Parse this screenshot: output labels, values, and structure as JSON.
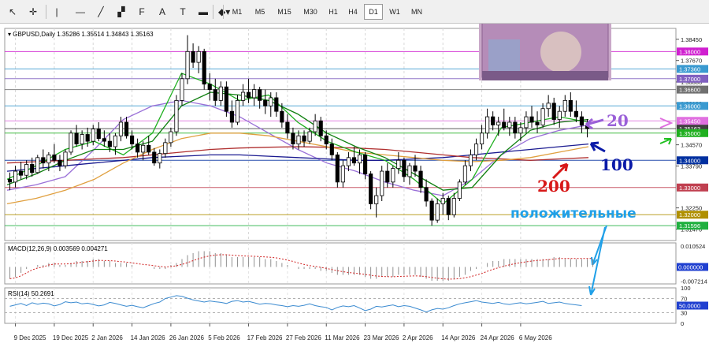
{
  "toolbar": {
    "tools": [
      {
        "name": "cursor-icon",
        "glyph": "↖"
      },
      {
        "name": "crosshair-icon",
        "glyph": "✛"
      },
      {
        "name": "vertical-line-icon",
        "glyph": "|"
      },
      {
        "name": "horizontal-line-icon",
        "glyph": "—"
      },
      {
        "name": "trendline-icon",
        "glyph": "╱"
      },
      {
        "name": "channel-icon",
        "glyph": "▞"
      },
      {
        "name": "fibonacci-icon",
        "glyph": "F"
      },
      {
        "name": "text-icon",
        "glyph": "A"
      },
      {
        "name": "label-icon",
        "glyph": "T"
      },
      {
        "name": "rectangle-icon",
        "glyph": "▬"
      },
      {
        "name": "shapes-icon",
        "glyph": "◆▾"
      }
    ],
    "timeframes": [
      "M1",
      "M5",
      "M15",
      "M30",
      "H1",
      "H4",
      "D1",
      "W1",
      "MN"
    ],
    "selected_timeframe": "D1"
  },
  "chart_data": {
    "type": "candlestick",
    "header": "GBPUSD,Daily  1.35286 1.35514 1.34843 1.35163",
    "x_ticks": [
      "9 Dec 2025",
      "19 Dec 2025",
      "2 Jan 2026",
      "14 Jan 2026",
      "26 Jan 2026",
      "5 Feb 2026",
      "17 Feb 2026",
      "27 Feb 2026",
      "11 Mar 2026",
      "23 Mar 2026",
      "2 Apr 2026",
      "14 Apr 2026",
      "24 Apr 2026",
      "6 May 2026"
    ],
    "price_ticks": [
      "1.38450",
      "1.37670",
      "1.36880",
      "1.36100",
      "1.34570",
      "1.33790",
      "1.32250",
      "1.31470"
    ],
    "price_levels": [
      {
        "label": "1.38000",
        "value": 1.38,
        "color": "#d020d0"
      },
      {
        "label": "1.37360",
        "value": 1.3736,
        "color": "#3a9ad0"
      },
      {
        "label": "1.37000",
        "value": 1.37,
        "color": "#8060c0"
      },
      {
        "label": "1.36600",
        "value": 1.366,
        "color": "#707070"
      },
      {
        "label": "1.36000",
        "value": 1.36,
        "color": "#3a9ad0"
      },
      {
        "label": "1.35450",
        "value": 1.3545,
        "color": "#e070e0"
      },
      {
        "label": "1.35163",
        "value": 1.35163,
        "color": "#404040"
      },
      {
        "label": "1.35000",
        "value": 1.35,
        "color": "#20b020"
      },
      {
        "label": "1.34000",
        "value": 1.34,
        "color": "#0030a0"
      },
      {
        "label": "1.33000",
        "value": 1.33,
        "color": "#c04050"
      },
      {
        "label": "1.32000",
        "value": 1.32,
        "color": "#b09000"
      },
      {
        "label": "1.31596",
        "value": 1.31596,
        "color": "#20b040"
      }
    ],
    "y_range": [
      1.3105,
      1.3885
    ],
    "annotations": [
      {
        "text": "20",
        "color": "#9a60d8"
      },
      {
        "text": "100",
        "color": "#0a1aa8"
      },
      {
        "text": "200",
        "color": "#d81818"
      },
      {
        "text": "положительные",
        "color": "#20a0e8"
      }
    ],
    "candles": [
      [
        1.333,
        1.3355,
        1.329,
        1.332
      ],
      [
        1.332,
        1.338,
        1.33,
        1.336
      ],
      [
        1.336,
        1.3395,
        1.333,
        1.3345
      ],
      [
        1.3345,
        1.34,
        1.333,
        1.3385
      ],
      [
        1.3385,
        1.341,
        1.334,
        1.3355
      ],
      [
        1.3355,
        1.342,
        1.335,
        1.341
      ],
      [
        1.341,
        1.344,
        1.337,
        1.339
      ],
      [
        1.339,
        1.343,
        1.336,
        1.342
      ],
      [
        1.342,
        1.346,
        1.339,
        1.34
      ],
      [
        1.34,
        1.342,
        1.336,
        1.338
      ],
      [
        1.338,
        1.344,
        1.337,
        1.343
      ],
      [
        1.343,
        1.351,
        1.342,
        1.35
      ],
      [
        1.35,
        1.353,
        1.345,
        1.346
      ],
      [
        1.346,
        1.351,
        1.344,
        1.3495
      ],
      [
        1.3495,
        1.352,
        1.345,
        1.347
      ],
      [
        1.347,
        1.353,
        1.3455,
        1.3515
      ],
      [
        1.3515,
        1.354,
        1.347,
        1.348
      ],
      [
        1.348,
        1.351,
        1.345,
        1.347
      ],
      [
        1.347,
        1.35,
        1.343,
        1.345
      ],
      [
        1.345,
        1.35,
        1.342,
        1.349
      ],
      [
        1.349,
        1.356,
        1.347,
        1.354
      ],
      [
        1.354,
        1.356,
        1.348,
        1.349
      ],
      [
        1.349,
        1.351,
        1.344,
        1.346
      ],
      [
        1.346,
        1.348,
        1.341,
        1.343
      ],
      [
        1.343,
        1.347,
        1.34,
        1.3455
      ],
      [
        1.3455,
        1.349,
        1.342,
        1.343
      ],
      [
        1.343,
        1.3445,
        1.338,
        1.339
      ],
      [
        1.339,
        1.344,
        1.337,
        1.3425
      ],
      [
        1.3425,
        1.348,
        1.341,
        1.3465
      ],
      [
        1.3465,
        1.352,
        1.345,
        1.3505
      ],
      [
        1.3505,
        1.364,
        1.349,
        1.362
      ],
      [
        1.362,
        1.372,
        1.36,
        1.37
      ],
      [
        1.37,
        1.386,
        1.368,
        1.38
      ],
      [
        1.38,
        1.383,
        1.374,
        1.376
      ],
      [
        1.376,
        1.382,
        1.372,
        1.38
      ],
      [
        1.38,
        1.381,
        1.366,
        1.368
      ],
      [
        1.368,
        1.372,
        1.362,
        1.366
      ],
      [
        1.366,
        1.37,
        1.36,
        1.362
      ],
      [
        1.362,
        1.369,
        1.36,
        1.367
      ],
      [
        1.367,
        1.369,
        1.356,
        1.358
      ],
      [
        1.358,
        1.362,
        1.352,
        1.354
      ],
      [
        1.354,
        1.364,
        1.353,
        1.362
      ],
      [
        1.362,
        1.368,
        1.36,
        1.365
      ],
      [
        1.365,
        1.37,
        1.361,
        1.363
      ],
      [
        1.363,
        1.368,
        1.36,
        1.366
      ],
      [
        1.366,
        1.367,
        1.359,
        1.362
      ],
      [
        1.362,
        1.366,
        1.357,
        1.36
      ],
      [
        1.36,
        1.365,
        1.356,
        1.363
      ],
      [
        1.363,
        1.365,
        1.356,
        1.358
      ],
      [
        1.358,
        1.361,
        1.352,
        1.354
      ],
      [
        1.354,
        1.357,
        1.348,
        1.35
      ],
      [
        1.35,
        1.352,
        1.344,
        1.346
      ],
      [
        1.346,
        1.351,
        1.344,
        1.349
      ],
      [
        1.349,
        1.351,
        1.345,
        1.347
      ],
      [
        1.347,
        1.352,
        1.346,
        1.3505
      ],
      [
        1.3505,
        1.357,
        1.349,
        1.3545
      ],
      [
        1.3545,
        1.356,
        1.347,
        1.349
      ],
      [
        1.349,
        1.351,
        1.344,
        1.346
      ],
      [
        1.346,
        1.348,
        1.34,
        1.342
      ],
      [
        1.342,
        1.343,
        1.33,
        1.332
      ],
      [
        1.332,
        1.34,
        1.33,
        1.338
      ],
      [
        1.338,
        1.343,
        1.336,
        1.341
      ],
      [
        1.341,
        1.345,
        1.338,
        1.339
      ],
      [
        1.339,
        1.344,
        1.335,
        1.342
      ],
      [
        1.342,
        1.343,
        1.333,
        1.335
      ],
      [
        1.335,
        1.336,
        1.322,
        1.324
      ],
      [
        1.324,
        1.33,
        1.319,
        1.327
      ],
      [
        1.327,
        1.338,
        1.325,
        1.336
      ],
      [
        1.336,
        1.339,
        1.33,
        1.332
      ],
      [
        1.332,
        1.338,
        1.33,
        1.337
      ],
      [
        1.337,
        1.343,
        1.335,
        1.34
      ],
      [
        1.34,
        1.341,
        1.332,
        1.334
      ],
      [
        1.334,
        1.339,
        1.331,
        1.338
      ],
      [
        1.338,
        1.342,
        1.334,
        1.336
      ],
      [
        1.336,
        1.338,
        1.328,
        1.33
      ],
      [
        1.33,
        1.333,
        1.323,
        1.325
      ],
      [
        1.325,
        1.326,
        1.316,
        1.318
      ],
      [
        1.318,
        1.326,
        1.317,
        1.324
      ],
      [
        1.324,
        1.328,
        1.32,
        1.326
      ],
      [
        1.326,
        1.327,
        1.318,
        1.32
      ],
      [
        1.32,
        1.328,
        1.319,
        1.326
      ],
      [
        1.326,
        1.333,
        1.325,
        1.332
      ],
      [
        1.332,
        1.34,
        1.331,
        1.338
      ],
      [
        1.338,
        1.344,
        1.336,
        1.342
      ],
      [
        1.342,
        1.348,
        1.34,
        1.346
      ],
      [
        1.346,
        1.353,
        1.344,
        1.35
      ],
      [
        1.35,
        1.359,
        1.348,
        1.356
      ],
      [
        1.356,
        1.358,
        1.351,
        1.353
      ],
      [
        1.353,
        1.356,
        1.349,
        1.354
      ],
      [
        1.354,
        1.359,
        1.351,
        1.352
      ],
      [
        1.352,
        1.356,
        1.349,
        1.354
      ],
      [
        1.354,
        1.356,
        1.348,
        1.35
      ],
      [
        1.35,
        1.354,
        1.347,
        1.352
      ],
      [
        1.352,
        1.358,
        1.35,
        1.356
      ],
      [
        1.356,
        1.36,
        1.352,
        1.354
      ],
      [
        1.354,
        1.358,
        1.35,
        1.353
      ],
      [
        1.353,
        1.361,
        1.352,
        1.359
      ],
      [
        1.359,
        1.364,
        1.356,
        1.361
      ],
      [
        1.361,
        1.363,
        1.353,
        1.355
      ],
      [
        1.355,
        1.36,
        1.352,
        1.358
      ],
      [
        1.358,
        1.364,
        1.356,
        1.362
      ],
      [
        1.362,
        1.365,
        1.356,
        1.358
      ],
      [
        1.358,
        1.362,
        1.354,
        1.356
      ],
      [
        1.356,
        1.358,
        1.35,
        1.3529
      ],
      [
        1.35286,
        1.35514,
        1.34843,
        1.35163
      ]
    ],
    "overlays": [
      {
        "name": "MA20",
        "color": "#9a70d8",
        "values": [
          1.329,
          1.331,
          1.334,
          1.344,
          1.355,
          1.36,
          1.362,
          1.36,
          1.356,
          1.35,
          1.344,
          1.339,
          1.336,
          1.332,
          1.329,
          1.327,
          1.333,
          1.342,
          1.348,
          1.351,
          1.353
        ]
      },
      {
        "name": "MA100",
        "color": "#1a1a90",
        "values": [
          1.336,
          1.337,
          1.338,
          1.339,
          1.34,
          1.341,
          1.3415,
          1.342,
          1.342,
          1.3415,
          1.341,
          1.3405,
          1.34,
          1.34,
          1.3405,
          1.341,
          1.342,
          1.343,
          1.344,
          1.345,
          1.346
        ]
      },
      {
        "name": "MA200",
        "color": "#b03030",
        "values": [
          1.339,
          1.3395,
          1.34,
          1.3405,
          1.341,
          1.342,
          1.343,
          1.344,
          1.3445,
          1.3448,
          1.345,
          1.3448,
          1.3445,
          1.344,
          1.343,
          1.342,
          1.341,
          1.3405,
          1.34,
          1.3405,
          1.341
        ]
      },
      {
        "name": "MA50",
        "color": "#e0a040",
        "values": [
          1.324,
          1.326,
          1.329,
          1.333,
          1.339,
          1.344,
          1.348,
          1.35,
          1.35,
          1.349,
          1.347,
          1.345,
          1.343,
          1.342,
          1.341,
          1.34,
          1.3395,
          1.34,
          1.341,
          1.343,
          1.345
        ]
      },
      {
        "name": "EMA5",
        "color": "#20b020",
        "values": [
          1.333,
          1.338,
          1.344,
          1.347,
          1.342,
          1.35,
          1.372,
          1.368,
          1.362,
          1.364,
          1.354,
          1.347,
          1.343,
          1.34,
          1.333,
          1.324,
          1.333,
          1.352,
          1.354,
          1.356,
          1.354
        ]
      },
      {
        "name": "EMA13",
        "color": "#108010",
        "values": [
          1.331,
          1.335,
          1.34,
          1.344,
          1.344,
          1.347,
          1.36,
          1.365,
          1.364,
          1.362,
          1.357,
          1.35,
          1.345,
          1.341,
          1.335,
          1.329,
          1.33,
          1.342,
          1.351,
          1.354,
          1.355
        ]
      }
    ],
    "macd": {
      "label": "MACD(12,26,9) 0.003569 0.004271",
      "ticks": [
        "0.010524",
        "0.000000",
        "-0.007214"
      ],
      "y_range": [
        -0.0086,
        0.0122
      ],
      "histogram": [
        -0.006,
        -0.005,
        -0.003,
        -0.001,
        0.0,
        0.001,
        0.001,
        0.002,
        0.002,
        0.001,
        0.001,
        0.002,
        0.003,
        0.003,
        0.003,
        0.004,
        0.004,
        0.003,
        0.003,
        0.002,
        0.002,
        0.002,
        0.001,
        0.0,
        0.0,
        0.0,
        -0.001,
        -0.001,
        -0.001,
        0.001,
        0.002,
        0.004,
        0.006,
        0.007,
        0.008,
        0.008,
        0.008,
        0.007,
        0.007,
        0.006,
        0.005,
        0.005,
        0.005,
        0.005,
        0.005,
        0.005,
        0.004,
        0.004,
        0.003,
        0.002,
        0.001,
        0.0,
        -0.001,
        -0.001,
        -0.001,
        -0.001,
        -0.002,
        -0.002,
        -0.003,
        -0.004,
        -0.004,
        -0.004,
        -0.004,
        -0.004,
        -0.005,
        -0.006,
        -0.006,
        -0.005,
        -0.005,
        -0.005,
        -0.004,
        -0.004,
        -0.004,
        -0.004,
        -0.005,
        -0.006,
        -0.007,
        -0.007,
        -0.007,
        -0.007,
        -0.006,
        -0.005,
        -0.004,
        -0.002,
        -0.001,
        0.0,
        0.002,
        0.003,
        0.003,
        0.004,
        0.004,
        0.004,
        0.004,
        0.004,
        0.004,
        0.004,
        0.004,
        0.004,
        0.005,
        0.005,
        0.004,
        0.004,
        0.004,
        0.004,
        0.004,
        0.004
      ],
      "signal": [
        -0.006,
        -0.0055,
        -0.0045,
        -0.003,
        -0.0015,
        -0.0005,
        0.0,
        0.001,
        0.0015,
        0.0015,
        0.0015,
        0.0017,
        0.002,
        0.0024,
        0.0027,
        0.003,
        0.0033,
        0.0033,
        0.0032,
        0.003,
        0.0027,
        0.0025,
        0.0021,
        0.0017,
        0.0013,
        0.001,
        0.0006,
        0.0003,
        0.0,
        0.0002,
        0.0006,
        0.0013,
        0.0022,
        0.0032,
        0.0042,
        0.005,
        0.0056,
        0.006,
        0.0062,
        0.0062,
        0.006,
        0.0058,
        0.0056,
        0.0055,
        0.0054,
        0.0053,
        0.0051,
        0.0049,
        0.0046,
        0.0041,
        0.0035,
        0.0028,
        0.002,
        0.0013,
        0.0007,
        0.0003,
        -0.0002,
        -0.0007,
        -0.0013,
        -0.0019,
        -0.0024,
        -0.0028,
        -0.0031,
        -0.0034,
        -0.0038,
        -0.0042,
        -0.0046,
        -0.0048,
        -0.0049,
        -0.005,
        -0.0048,
        -0.0047,
        -0.0046,
        -0.0045,
        -0.0046,
        -0.0049,
        -0.0053,
        -0.0057,
        -0.006,
        -0.0062,
        -0.0061,
        -0.0059,
        -0.0055,
        -0.0049,
        -0.0041,
        -0.0033,
        -0.0022,
        -0.0012,
        -0.0004,
        0.0004,
        0.0011,
        0.0017,
        0.0022,
        0.0026,
        0.003,
        0.0033,
        0.0035,
        0.0037,
        0.004,
        0.0043,
        0.0043,
        0.0043,
        0.0043,
        0.0043,
        0.0043,
        0.0043
      ]
    },
    "rsi": {
      "label": "RSI(14) 50.2691",
      "ticks": [
        "100",
        "70",
        "50.0000",
        "30",
        "0"
      ],
      "levels": [
        70,
        30
      ],
      "values": [
        48,
        52,
        56,
        50,
        58,
        54,
        57,
        55,
        49,
        53,
        61,
        58,
        60,
        55,
        57,
        53,
        49,
        52,
        59,
        56,
        52,
        48,
        51,
        47,
        44,
        50,
        56,
        60,
        70,
        74,
        78,
        76,
        71,
        66,
        63,
        60,
        63,
        61,
        59,
        56,
        62,
        64,
        60,
        62,
        58,
        54,
        56,
        55,
        52,
        50,
        47,
        50,
        48,
        51,
        55,
        50,
        47,
        45,
        38,
        45,
        49,
        47,
        50,
        43,
        36,
        40,
        48,
        46,
        49,
        52,
        47,
        50,
        48,
        43,
        38,
        32,
        38,
        42,
        40,
        44,
        50,
        55,
        58,
        61,
        64,
        60,
        58,
        56,
        59,
        55,
        53,
        56,
        58,
        55,
        57,
        59,
        62,
        56,
        58,
        60,
        56,
        54,
        52,
        50
      ]
    }
  }
}
